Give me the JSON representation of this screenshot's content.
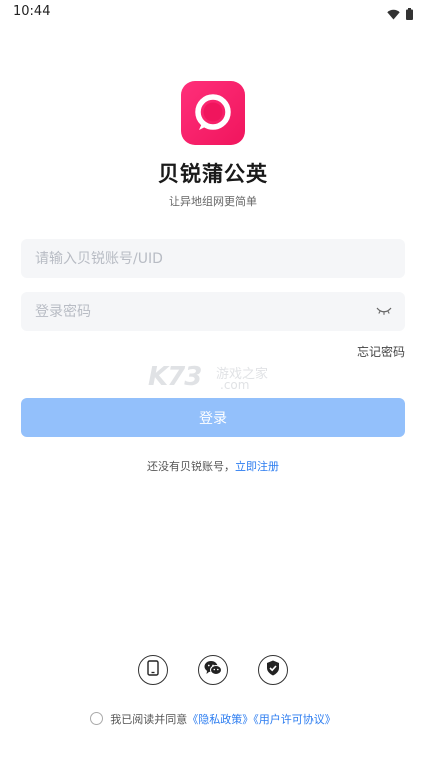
{
  "status_bar": {
    "time": "10:44",
    "icons": [
      "wifi-icon",
      "battery-icon"
    ]
  },
  "app": {
    "name": "贝锐蒲公英",
    "tagline": "让异地组网更简单",
    "brand_color": "#f0155d"
  },
  "form": {
    "account_placeholder": "请输入贝锐账号/UID",
    "account_value": "",
    "password_placeholder": "登录密码",
    "password_value": "",
    "forgot_label": "忘记密码",
    "login_label": "登录",
    "login_button_color": "#93c0fb"
  },
  "watermark": {
    "logo": "K73",
    "cn": "游戏之家",
    "com": ".com"
  },
  "register": {
    "prompt": "还没有贝锐账号，",
    "link": "立即注册",
    "link_color": "#2b7cf0"
  },
  "social": {
    "icons": [
      "phone-icon",
      "wechat-icon",
      "shield-check-icon"
    ]
  },
  "agreement": {
    "prefix": "我已阅读并同意",
    "privacy": "《隐私政策》",
    "license": "《用户许可协议》"
  }
}
